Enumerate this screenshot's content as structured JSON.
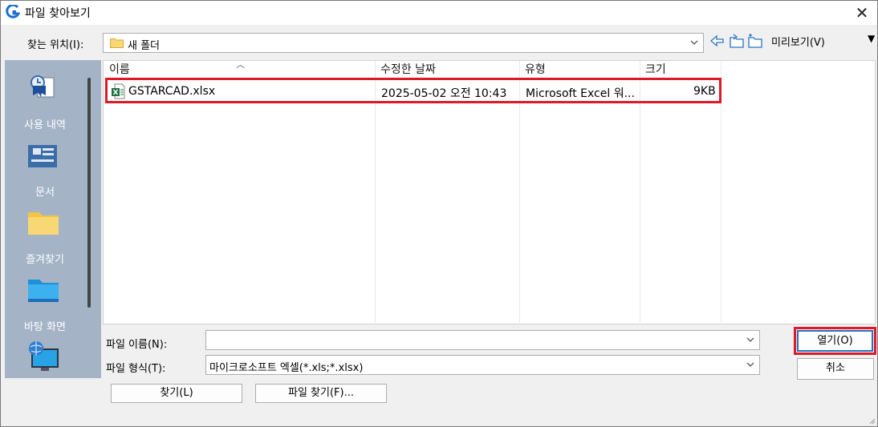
{
  "window": {
    "title": "파일 찾아보기",
    "close_glyph": "✕"
  },
  "lookin": {
    "label": "찾는 위치(I):",
    "value": "새 폴더"
  },
  "toolbar": {
    "preview_label": "미리보기(V)",
    "menu_arrow": "▼"
  },
  "places": [
    {
      "label": "사용 내역",
      "icon": "history-icon"
    },
    {
      "label": "문서",
      "icon": "documents-icon"
    },
    {
      "label": "즐겨찾기",
      "icon": "favorites-folder-icon"
    },
    {
      "label": "바탕 화면",
      "icon": "desktop-icon"
    },
    {
      "label": "",
      "icon": "network-computer-icon"
    }
  ],
  "filelist": {
    "columns": [
      "이름",
      "수정한 날짜",
      "유형",
      "크기"
    ],
    "rows": [
      {
        "name": "GSTARCAD.xlsx",
        "date": "2025-05-02 오전 10:43",
        "type": "Microsoft Excel 워...",
        "size": "9KB",
        "icon": "excel-file-icon"
      }
    ]
  },
  "filename": {
    "label": "파일 이름(N):",
    "value": ""
  },
  "filetype": {
    "label": "파일 형식(T):",
    "value": "마이크로소프트 엑셀(*.xls;*.xlsx)"
  },
  "buttons": {
    "open": "열기(O)",
    "cancel": "취소",
    "find": "찾기(L)",
    "find_file": "파일 찾기(F)..."
  },
  "colors": {
    "highlight": "#e0192a",
    "places_bg": "#a4b3c6",
    "focus": "#2a6fbe"
  }
}
